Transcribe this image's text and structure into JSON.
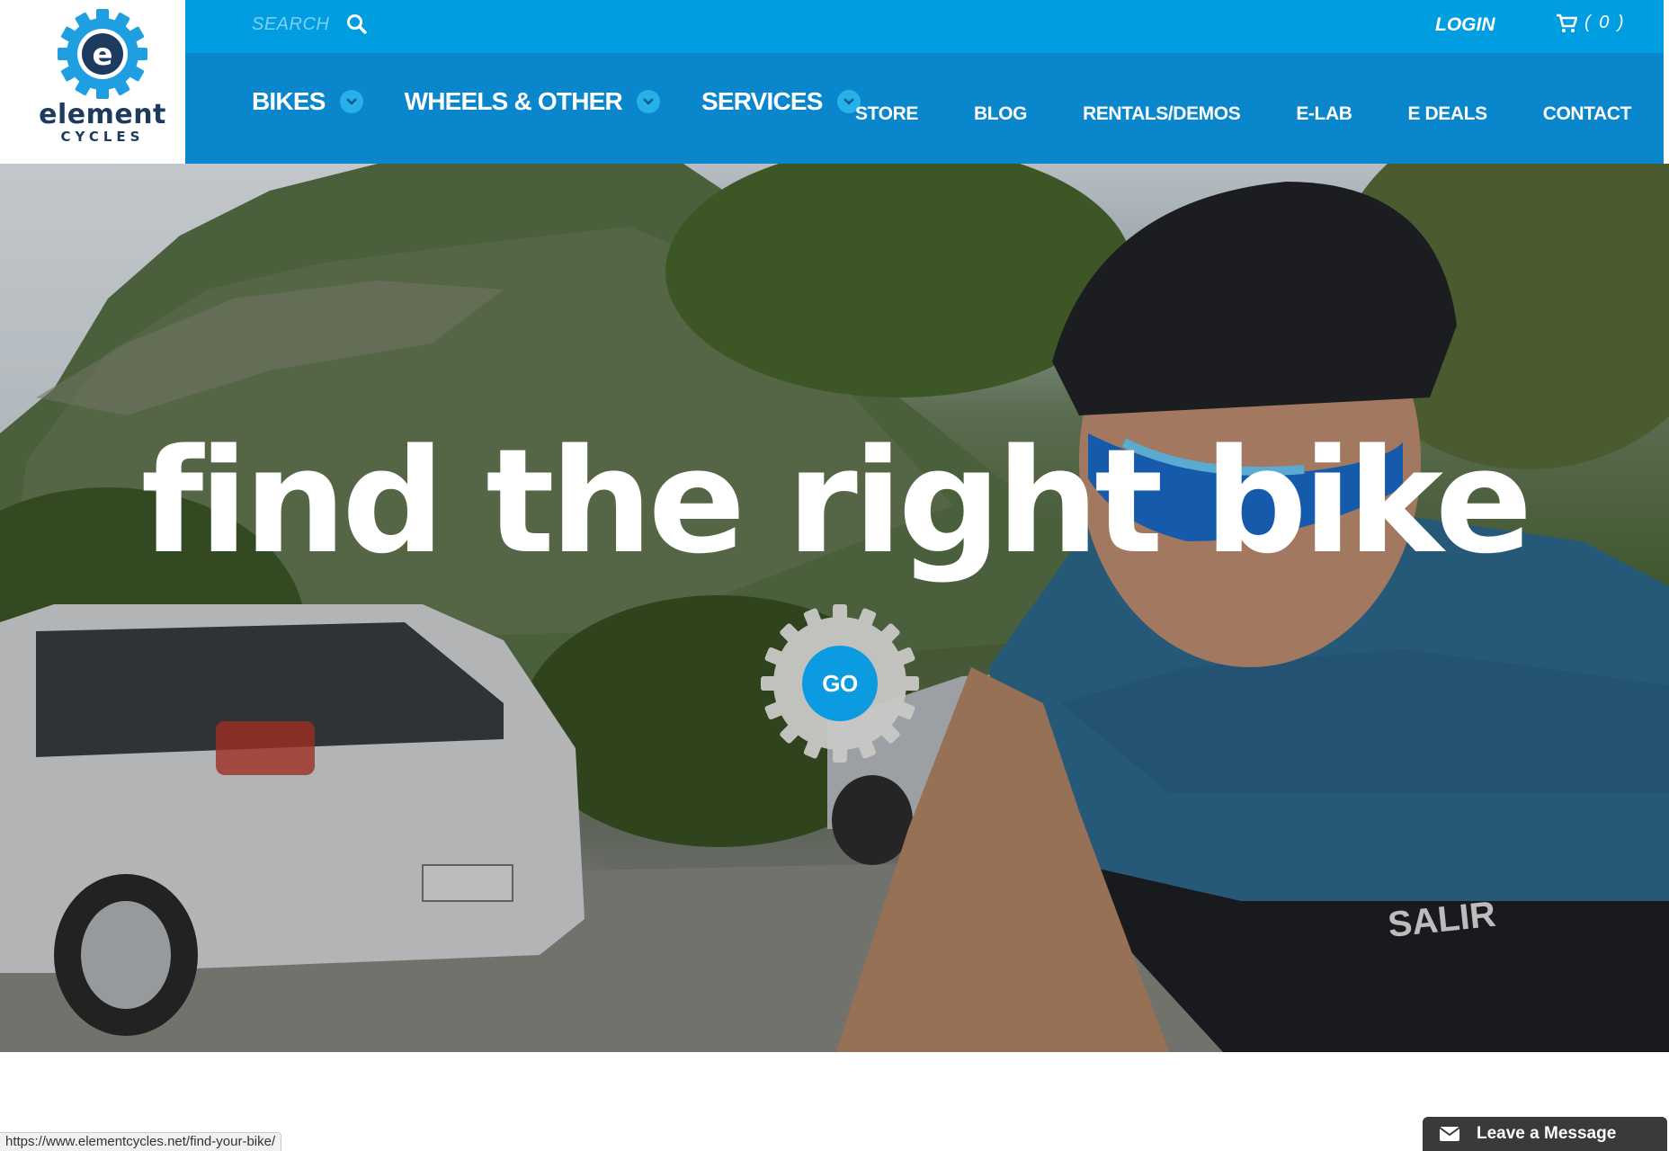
{
  "brand": {
    "name": "element",
    "tagline": "CYCLES",
    "logo_letter": "e",
    "colors": {
      "primary": "#0a86cc",
      "topbar": "#009de0",
      "logo_blue": "#1f9ee2",
      "logo_navy": "#1d3a5f"
    }
  },
  "topbar": {
    "search_label": "SEARCH",
    "search_icon": "search-icon",
    "login_label": "LOGIN",
    "cart_icon": "cart-icon",
    "cart_count": "( 0 )"
  },
  "main_nav": [
    {
      "label": "BIKES",
      "icon": "chevron-down-icon"
    },
    {
      "label": "WHEELS & OTHER",
      "icon": "chevron-down-icon"
    },
    {
      "label": "SERVICES",
      "icon": "chevron-down-icon"
    }
  ],
  "secondary_nav": [
    "STORE",
    "BLOG",
    "RENTALS/DEMOS",
    "E-LAB",
    "E DEALS",
    "CONTACT"
  ],
  "hero": {
    "title": "find the right bike",
    "cta_label": "GO"
  },
  "status_bar": {
    "url": "https://www.elementcycles.net/find-your-bike/"
  },
  "chat_widget": {
    "label": "Leave a Message",
    "icon": "envelope-icon"
  }
}
